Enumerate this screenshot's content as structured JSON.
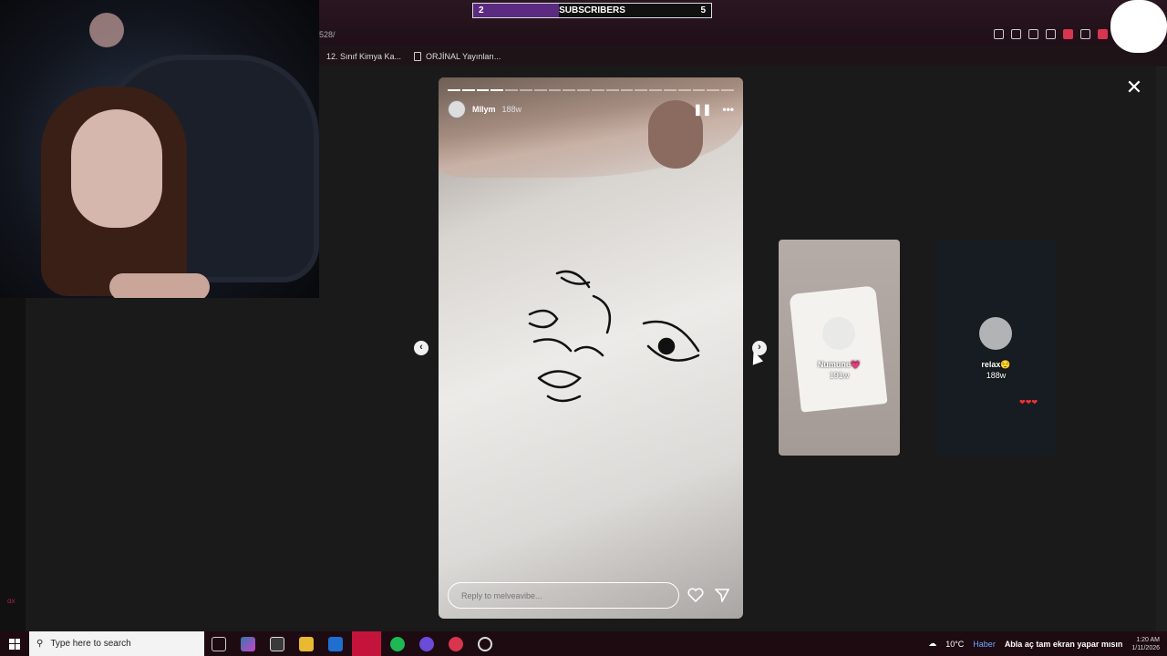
{
  "overlay": {
    "subs_current": "2",
    "subs_label": "SUBSCRIBERS",
    "subs_goal": "5"
  },
  "browser": {
    "url_fragment": "528/",
    "bookmarks": [
      {
        "label": "12. Sınıf Kimya Ka..."
      },
      {
        "label": "ORJİNAL Yayınları..."
      }
    ]
  },
  "story": {
    "username": "Mllym",
    "time": "188w",
    "progress_total": 20,
    "progress_done": 4,
    "pause_icon": "pause-icon",
    "more_icon": "more-icon",
    "reply_placeholder": "Reply to melveavibe...",
    "close_symbol": "✕",
    "prev_symbol": "‹",
    "next_symbol": "›"
  },
  "previews": [
    {
      "name": "Numune💗",
      "time": "191w"
    },
    {
      "name": "relax😌",
      "time": "188w",
      "hearts": "❤❤❤"
    }
  ],
  "webcam": {
    "side_text": "ɑx"
  },
  "taskbar": {
    "search_placeholder": "Type here to search",
    "weather": "10°C",
    "ticker_short": "Haber",
    "ticker": "Abla aç tam ekran yapar mısın",
    "time": "1:20 AM",
    "date": "1/11/2026"
  },
  "colors": {
    "accent": "#c4143c",
    "subs_fill": "#5a2b80",
    "taskbar": "#1e0b12"
  }
}
